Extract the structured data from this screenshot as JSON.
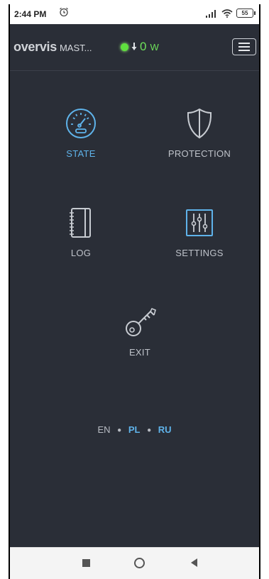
{
  "status_bar": {
    "time": "2:44 PM",
    "battery": "55",
    "icons": [
      "alarm-icon",
      "signal-icon",
      "wifi-icon",
      "battery-icon"
    ]
  },
  "header": {
    "brand": "overvis",
    "device_name": "MAST...",
    "power_value": "0",
    "power_unit": "W",
    "power_status_color": "#5fe03e"
  },
  "menu": {
    "items": [
      {
        "label": "STATE",
        "icon": "gauge-icon",
        "active": true
      },
      {
        "label": "PROTECTION",
        "icon": "shield-icon",
        "active": false
      },
      {
        "label": "LOG",
        "icon": "notebook-icon",
        "active": false
      },
      {
        "label": "SETTINGS",
        "icon": "sliders-icon",
        "active": false
      },
      {
        "label": "EXIT",
        "icon": "key-icon",
        "active": false
      }
    ]
  },
  "languages": {
    "current": "EN",
    "options": [
      "PL",
      "RU"
    ]
  },
  "colors": {
    "background": "#2a2e37",
    "accent": "#5fb3ea",
    "icon_gray": "#c7cbd1"
  },
  "nav_bar": {
    "icons": [
      "recents-icon",
      "home-icon",
      "back-icon"
    ]
  }
}
